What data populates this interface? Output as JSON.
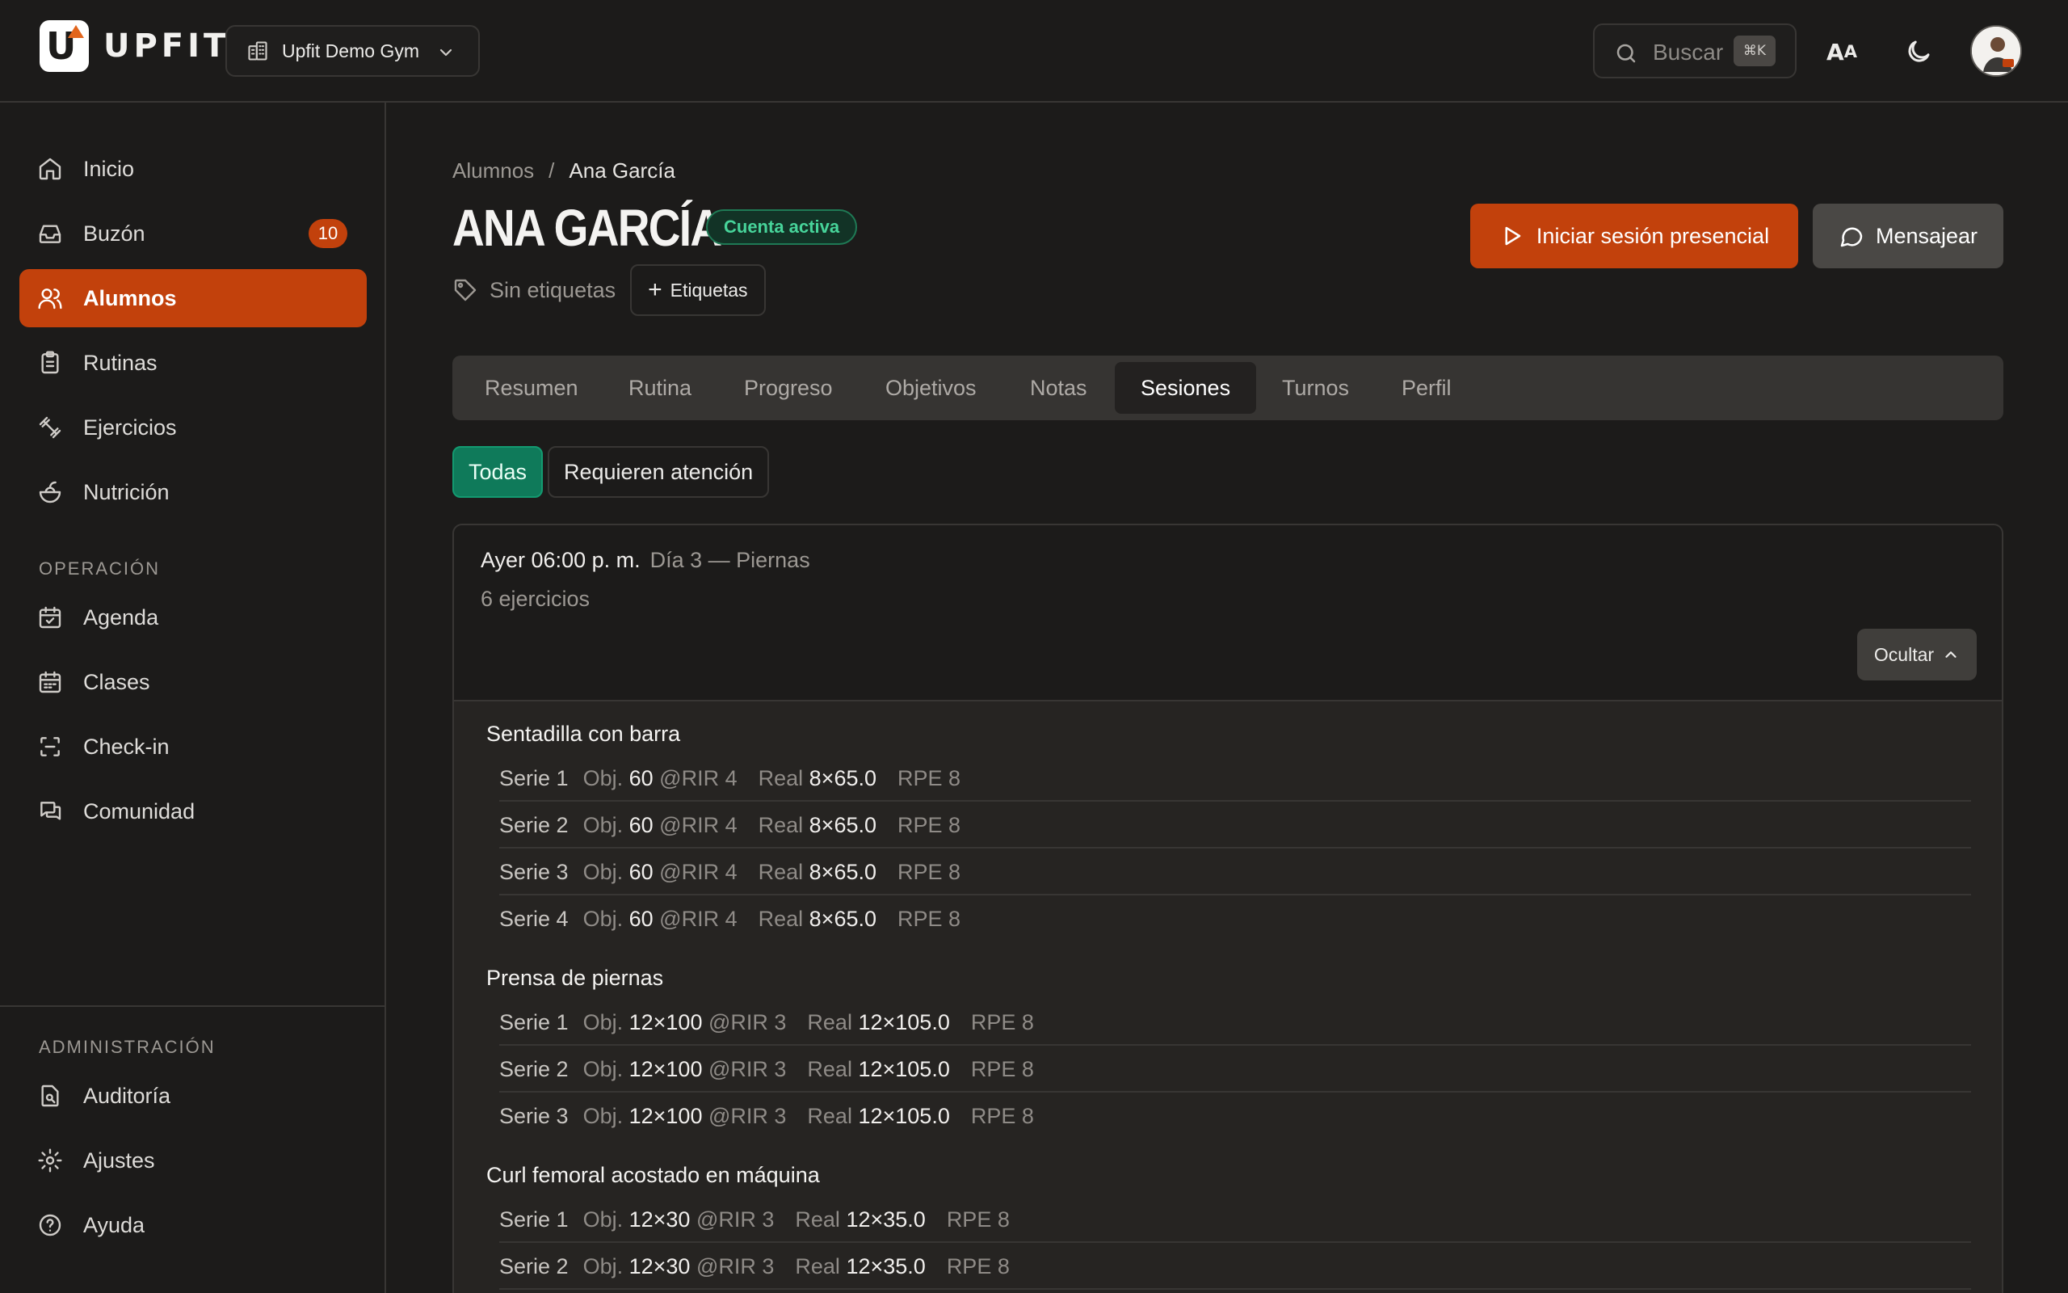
{
  "topbar": {
    "brand": "UPFIT",
    "logo_letter": "U",
    "gym_name": "Upfit Demo Gym",
    "search_placeholder": "Buscar",
    "search_shortcut": "⌘K",
    "font_size_big": "A",
    "font_size_small": "A"
  },
  "sidebar": {
    "items": [
      {
        "label": "Inicio",
        "icon": "home-icon"
      },
      {
        "label": "Buzón",
        "icon": "inbox-icon",
        "badge": "10"
      },
      {
        "label": "Alumnos",
        "icon": "users-icon",
        "active": true
      },
      {
        "label": "Rutinas",
        "icon": "clipboard-icon"
      },
      {
        "label": "Ejercicios",
        "icon": "dumbbell-icon"
      },
      {
        "label": "Nutrición",
        "icon": "salad-icon"
      }
    ],
    "operation_label": "OPERACIÓN",
    "operation_items": [
      {
        "label": "Agenda",
        "icon": "calendar-check-icon"
      },
      {
        "label": "Clases",
        "icon": "calendar-icon"
      },
      {
        "label": "Check-in",
        "icon": "scan-icon"
      },
      {
        "label": "Comunidad",
        "icon": "chat-icon"
      }
    ],
    "admin_label": "ADMINISTRACIÓN",
    "admin_items": [
      {
        "label": "Auditoría",
        "icon": "audit-icon"
      },
      {
        "label": "Ajustes",
        "icon": "gear-icon"
      },
      {
        "label": "Ayuda",
        "icon": "help-icon"
      }
    ]
  },
  "breadcrumb": {
    "parent": "Alumnos",
    "separator": "/",
    "current": "Ana García"
  },
  "profile": {
    "name": "ANA GARCÍA",
    "status": "Cuenta activa",
    "no_tags": "Sin etiquetas",
    "tags_button": "Etiquetas",
    "tags_button_prefix": "+"
  },
  "actions": {
    "start_session": "Iniciar sesión presencial",
    "message": "Mensajear"
  },
  "tabs": [
    "Resumen",
    "Rutina",
    "Progreso",
    "Objetivos",
    "Notas",
    "Sesiones",
    "Turnos",
    "Perfil"
  ],
  "active_tab": "Sesiones",
  "filters": {
    "all": "Todas",
    "attention": "Requieren atención"
  },
  "session": {
    "when": "Ayer 06:00 p. m.",
    "day": "Día 3 — Piernas",
    "exercise_count": "6 ejercicios",
    "hide_label": "Ocultar",
    "exercises": [
      {
        "name": "Sentadilla con barra",
        "sets": [
          {
            "serie": "Serie 1",
            "obj_label": "Obj.",
            "obj": "60",
            "rir": "@RIR 4",
            "real_label": "Real",
            "real": "8×65.0",
            "rpe": "RPE 8"
          },
          {
            "serie": "Serie 2",
            "obj_label": "Obj.",
            "obj": "60",
            "rir": "@RIR 4",
            "real_label": "Real",
            "real": "8×65.0",
            "rpe": "RPE 8"
          },
          {
            "serie": "Serie 3",
            "obj_label": "Obj.",
            "obj": "60",
            "rir": "@RIR 4",
            "real_label": "Real",
            "real": "8×65.0",
            "rpe": "RPE 8"
          },
          {
            "serie": "Serie 4",
            "obj_label": "Obj.",
            "obj": "60",
            "rir": "@RIR 4",
            "real_label": "Real",
            "real": "8×65.0",
            "rpe": "RPE 8"
          }
        ]
      },
      {
        "name": "Prensa de piernas",
        "sets": [
          {
            "serie": "Serie 1",
            "obj_label": "Obj.",
            "obj": "12×100",
            "rir": "@RIR 3",
            "real_label": "Real",
            "real": "12×105.0",
            "rpe": "RPE 8"
          },
          {
            "serie": "Serie 2",
            "obj_label": "Obj.",
            "obj": "12×100",
            "rir": "@RIR 3",
            "real_label": "Real",
            "real": "12×105.0",
            "rpe": "RPE 8"
          },
          {
            "serie": "Serie 3",
            "obj_label": "Obj.",
            "obj": "12×100",
            "rir": "@RIR 3",
            "real_label": "Real",
            "real": "12×105.0",
            "rpe": "RPE 8"
          }
        ]
      },
      {
        "name": "Curl femoral acostado en máquina",
        "sets": [
          {
            "serie": "Serie 1",
            "obj_label": "Obj.",
            "obj": "12×30",
            "rir": "@RIR 3",
            "real_label": "Real",
            "real": "12×35.0",
            "rpe": "RPE 8"
          },
          {
            "serie": "Serie 2",
            "obj_label": "Obj.",
            "obj": "12×30",
            "rir": "@RIR 3",
            "real_label": "Real",
            "real": "12×35.0",
            "rpe": "RPE 8"
          }
        ]
      }
    ]
  },
  "colors": {
    "accent": "#c2410c",
    "success": "#0f7a5a",
    "status_text": "#47d49a",
    "background": "#1c1b1a"
  }
}
